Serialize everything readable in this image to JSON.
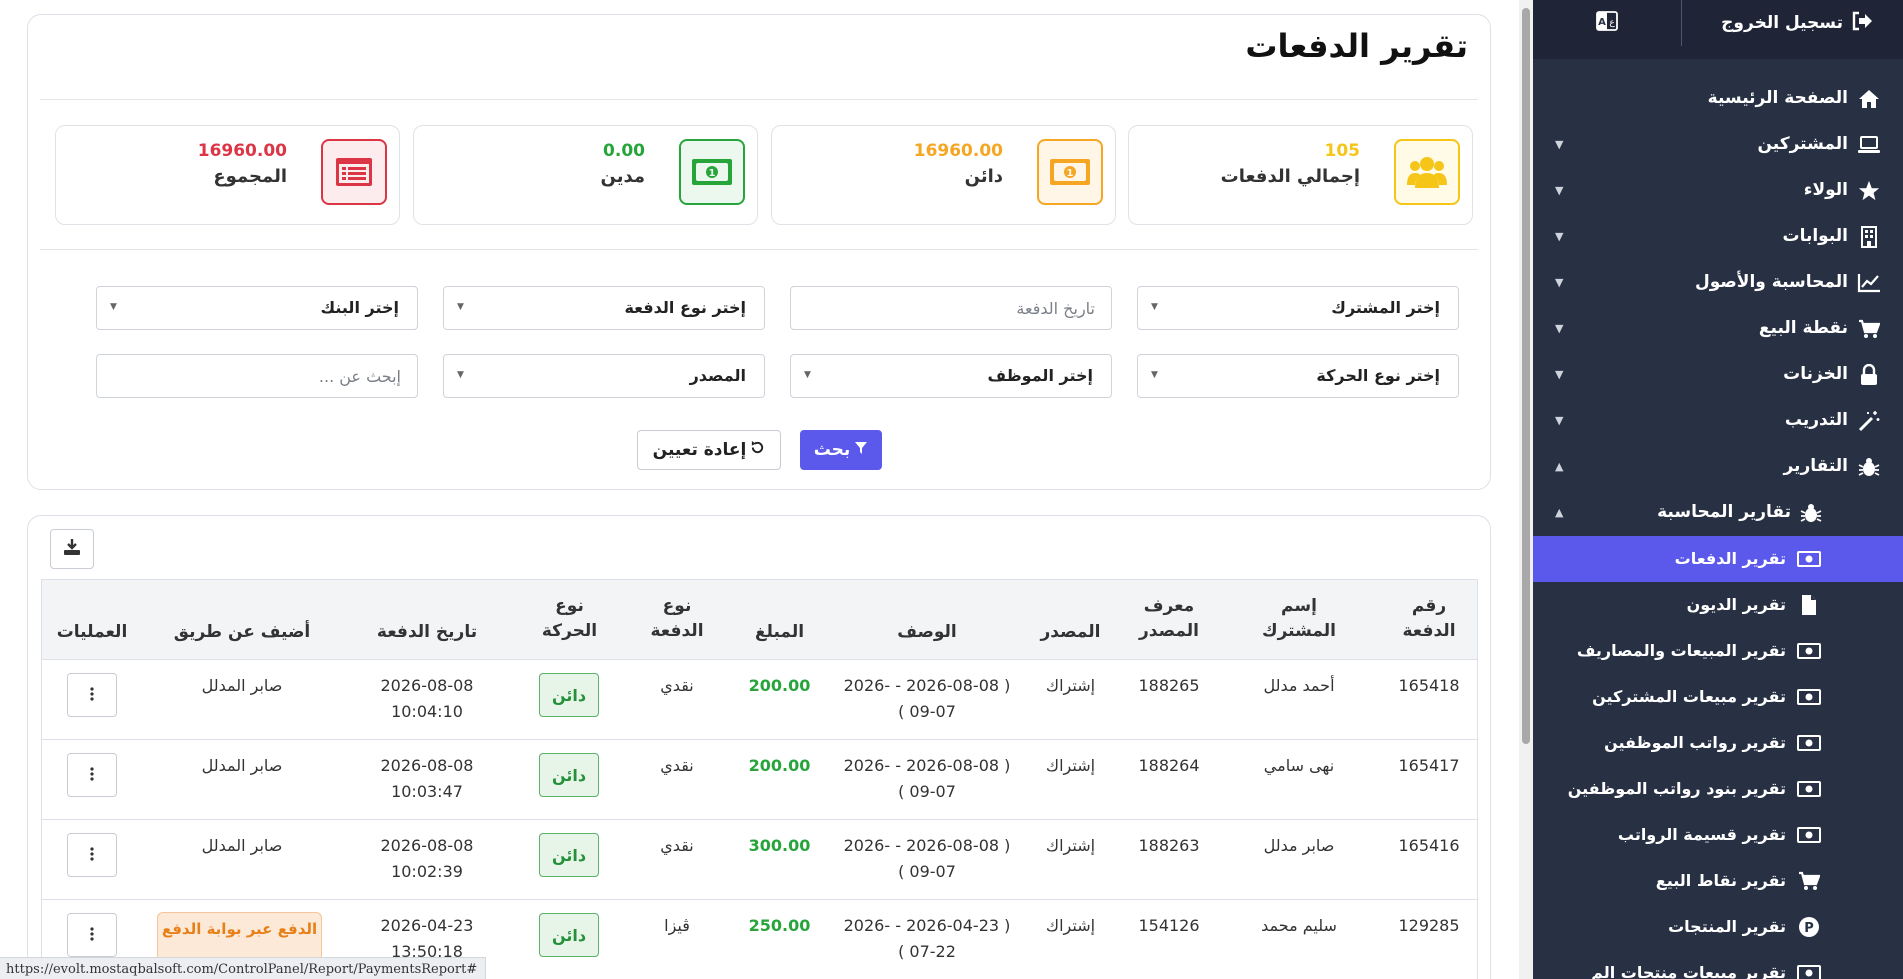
{
  "sidebar": {
    "logout_label": "تسجيل الخروج",
    "menu": [
      {
        "label": "الصفحة الرئيسية",
        "icon": "home-icon"
      },
      {
        "label": "المشتركين",
        "icon": "laptop-icon"
      },
      {
        "label": "الولاء",
        "icon": "star-icon"
      },
      {
        "label": "البوابات",
        "icon": "building-icon"
      },
      {
        "label": "المحاسبة والأصول",
        "icon": "chart-line-icon"
      },
      {
        "label": "نقطة البيع",
        "icon": "cart-icon"
      },
      {
        "label": "الخزنات",
        "icon": "lock-icon"
      },
      {
        "label": "التدريب",
        "icon": "magic-wand-icon"
      },
      {
        "label": "التقارير",
        "icon": "bug-icon"
      }
    ],
    "submenu_label": "تقارير المحاسبة",
    "reports": [
      {
        "label": "تقرير الدفعات",
        "icon": "money-bill-icon"
      },
      {
        "label": "تقرير الديون",
        "icon": "file-icon"
      },
      {
        "label": "تقرير المبيعات والمصاريف",
        "icon": "money-bill-icon"
      },
      {
        "label": "تقرير مبيعات المشتركين",
        "icon": "money-bill-icon"
      },
      {
        "label": "تقرير رواتب الموظفين",
        "icon": "money-bill-icon"
      },
      {
        "label": "تقرير بنود رواتب الموظفين",
        "icon": "money-bill-icon"
      },
      {
        "label": "تقرير قسيمة الرواتب",
        "icon": "money-bill-icon"
      },
      {
        "label": "تقرير نقاط البيع",
        "icon": "cart-icon"
      },
      {
        "label": "تقرير المنتجات",
        "icon": "product-p-icon"
      },
      {
        "label": "تقرير مبيعات منتجات الم",
        "icon": "money-bill-icon"
      }
    ]
  },
  "page": {
    "title": "تقرير الدفعات"
  },
  "stats": [
    {
      "value": "105",
      "label": "إجمالي الدفعات",
      "color": "#f5c518",
      "icon": "users-icon"
    },
    {
      "value": "16960.00",
      "label": "دائن",
      "color": "#f5a623",
      "icon": "money-bill-icon"
    },
    {
      "value": "0.00",
      "label": "مدين",
      "color": "#27a53b",
      "icon": "money-bill-icon"
    },
    {
      "value": "16960.00",
      "label": "المجموع",
      "color": "#dc3545",
      "icon": "list-alt-icon"
    }
  ],
  "filters": {
    "subscriber": "إختر المشترك",
    "payment_date_placeholder": "تاريخ الدفعة",
    "payment_type": "إختر نوع الدفعة",
    "bank": "إختر البنك",
    "movement_type": "إختر نوع الحركة",
    "employee": "إختر الموظف",
    "source": "المصدر",
    "search_placeholder": "إبحث عن ..."
  },
  "buttons": {
    "search": "بحث",
    "reset": "إعادة تعيين"
  },
  "table": {
    "headers": {
      "payment_no": [
        "رقم",
        "الدفعة"
      ],
      "subscriber_name": [
        "إسم",
        "المشترك"
      ],
      "source_id": [
        "معرف",
        "المصدر"
      ],
      "source": "المصدر",
      "description": "الوصف",
      "amount": "المبلغ",
      "payment_type": [
        "نوع",
        "الدفعة"
      ],
      "movement_type": [
        "نوع",
        "الحركة"
      ],
      "payment_date": "تاريخ الدفعة",
      "added_by": "أضيف عن طريق",
      "operations": "العمليات"
    },
    "rows": [
      {
        "payment_no": "165418",
        "subscriber_name": "أحمد مدلل",
        "source_id": "188265",
        "source": "إشتراك",
        "description": [
          "( 2026-08-08 - -2026",
          "09-07 )"
        ],
        "amount": "200.00",
        "payment_type": "نقدي",
        "movement_type": "دائن",
        "payment_date": [
          "2026-08-08",
          "10:04:10"
        ],
        "added_by": "صابر المدلل"
      },
      {
        "payment_no": "165417",
        "subscriber_name": "نهى سامي",
        "source_id": "188264",
        "source": "إشتراك",
        "description": [
          "( 2026-08-08 - -2026",
          "09-07 )"
        ],
        "amount": "200.00",
        "payment_type": "نقدي",
        "movement_type": "دائن",
        "payment_date": [
          "2026-08-08",
          "10:03:47"
        ],
        "added_by": "صابر المدلل"
      },
      {
        "payment_no": "165416",
        "subscriber_name": "صابر مدلل",
        "source_id": "188263",
        "source": "إشتراك",
        "description": [
          "( 2026-08-08 - -2026",
          "09-07 )"
        ],
        "amount": "300.00",
        "payment_type": "نقدي",
        "movement_type": "دائن",
        "payment_date": [
          "2026-08-08",
          "10:02:39"
        ],
        "added_by": "صابر المدلل"
      },
      {
        "payment_no": "129285",
        "subscriber_name": "سليم محمد",
        "source_id": "154126",
        "source": "إشتراك",
        "description": [
          "( 2026-04-23 - -2026",
          "07-22 )"
        ],
        "amount": "250.00",
        "payment_type": "ڤيزا",
        "movement_type": "دائن",
        "payment_date": [
          "2026-04-23",
          "13:50:18"
        ],
        "added_by": "الدفع عبر بوابة الدفع"
      }
    ]
  },
  "status_url": "https://evolt.mostaqbalsoft.com/ControlPanel/Report/PaymentsReport#"
}
